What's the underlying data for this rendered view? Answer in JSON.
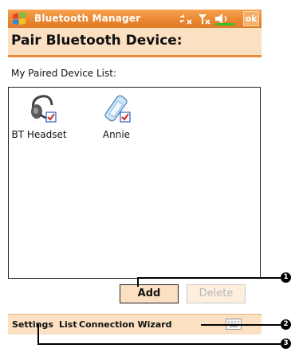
{
  "window": {
    "title": "Bluetooth Manager",
    "ok_label": "ok",
    "start_icon": "windows-flag-icon",
    "tray_icons": [
      "connectivity-icon",
      "signal-off-icon",
      "volume-icon"
    ]
  },
  "page": {
    "header": "Pair Bluetooth Device:",
    "list_label": "My Paired Device List:"
  },
  "devices": [
    {
      "label": "BT Headset",
      "icon": "headset-icon",
      "checked": true
    },
    {
      "label": "Annie",
      "icon": "phone-icon",
      "checked": true
    }
  ],
  "buttons": {
    "add": "Add",
    "delete": "Delete"
  },
  "menubar": {
    "settings": "Settings",
    "list": "List",
    "connection_wizard": "Connection Wizard",
    "keyboard_icon": "keyboard-icon"
  },
  "callouts": [
    "1",
    "2",
    "3"
  ],
  "colors": {
    "title_bar": "#ec8a34",
    "header_bg": "#fbe0c2",
    "accent": "#ea8a3a"
  }
}
